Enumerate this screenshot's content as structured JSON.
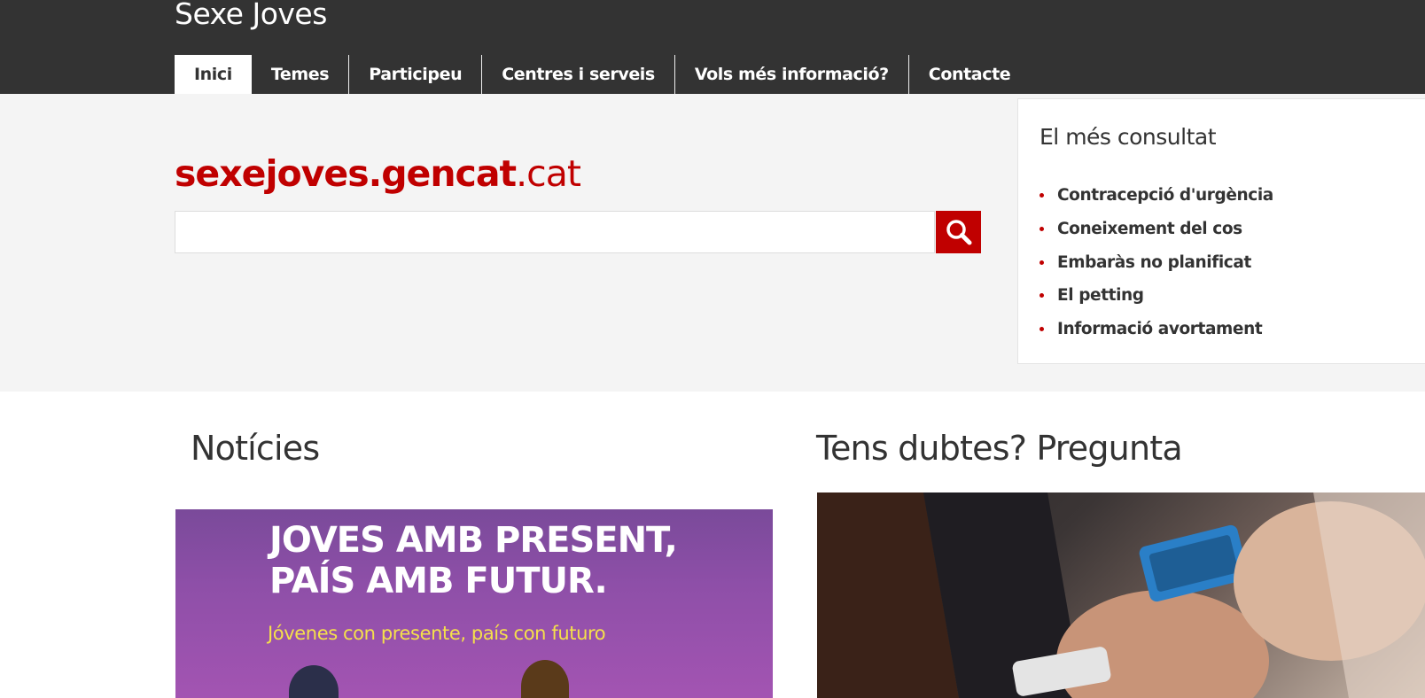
{
  "header": {
    "site_title": "Sexe Joves",
    "nav": [
      {
        "label": "Inici",
        "active": true
      },
      {
        "label": "Temes"
      },
      {
        "label": "Participeu"
      },
      {
        "label": "Centres i serveis"
      },
      {
        "label": "Vols més informació?"
      },
      {
        "label": "Contacte"
      }
    ]
  },
  "hero": {
    "logo_brand": "sexejoves.gencat",
    "logo_tld": ".cat",
    "search": {
      "placeholder": "",
      "value": "",
      "icon": "search-icon"
    }
  },
  "popular": {
    "title": "El més consultat",
    "items": [
      "Contracepció d'urgència",
      "Coneixement del cos",
      "Embaràs no planificat",
      "El petting",
      "Informació avortament"
    ]
  },
  "news": {
    "title": "Notícies",
    "banner_line1": "JOVES AMB PRESENT,",
    "banner_line2": "PAÍS AMB FUTUR.",
    "banner_sub": "Jóvenes con presente, país con futuro"
  },
  "ask": {
    "title": "Tens dubtes? Pregunta"
  },
  "colors": {
    "header_bg": "#333333",
    "accent": "#c00000",
    "hero_bg": "#f4f4f4",
    "banner_purple": "#8e4fa8",
    "banner_yellow": "#f5e04a"
  }
}
